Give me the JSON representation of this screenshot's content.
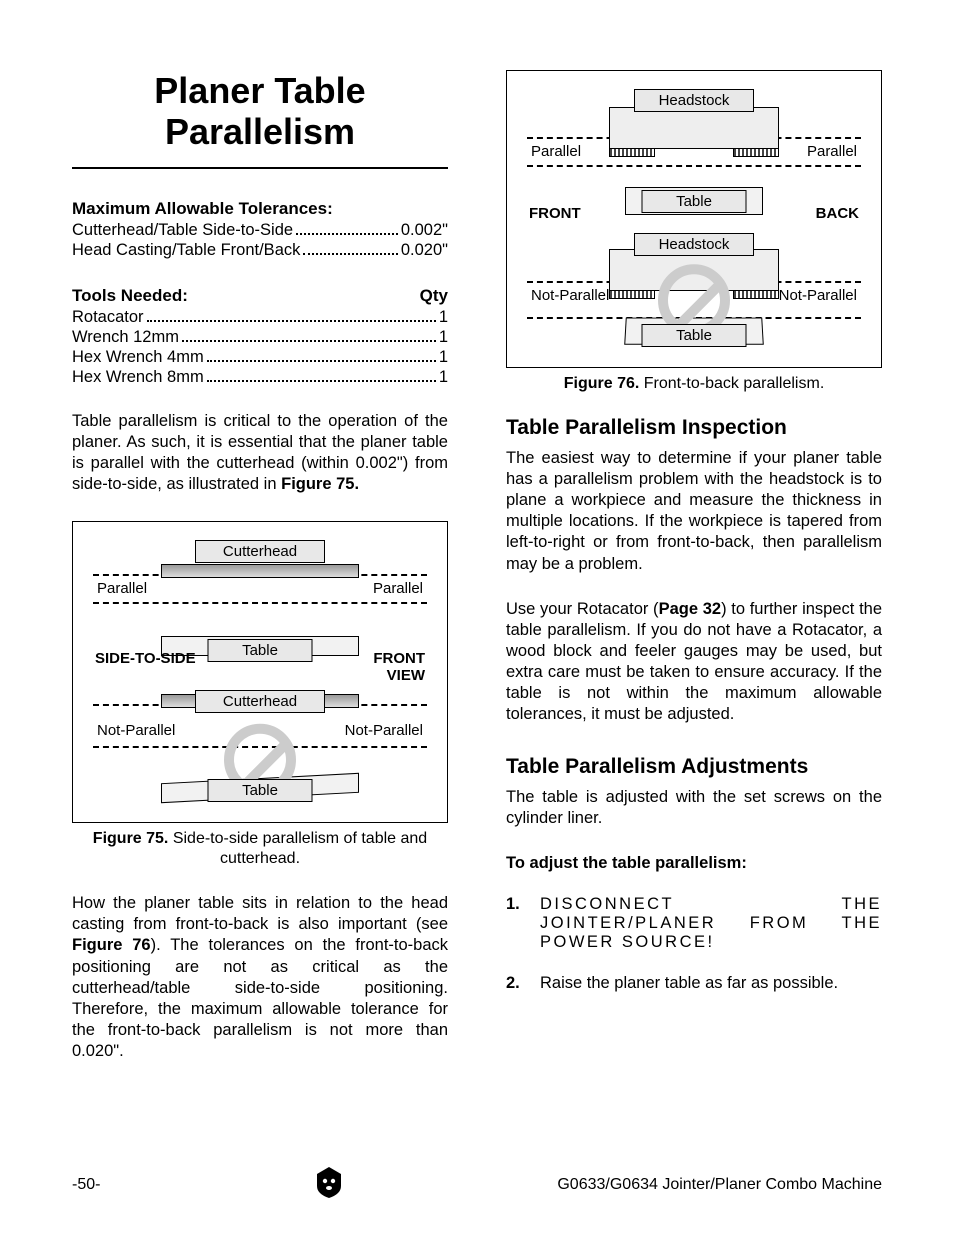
{
  "title_line1": "Planer Table",
  "title_line2": "Parallelism",
  "tolerances": {
    "heading": "Maximum Allowable Tolerances:",
    "rows": [
      {
        "label": "Cutterhead/Table Side-to-Side",
        "value": "0.002\""
      },
      {
        "label": "Head Casting/Table Front/Back",
        "value": "0.020\""
      }
    ]
  },
  "tools": {
    "heading": "Tools Needed:",
    "qty_label": "Qty",
    "rows": [
      {
        "label": "Rotacator",
        "value": "1"
      },
      {
        "label": "Wrench 12mm",
        "value": "1"
      },
      {
        "label": "Hex Wrench 4mm",
        "value": "1"
      },
      {
        "label": "Hex Wrench 8mm",
        "value": "1"
      }
    ]
  },
  "para1_a": "Table parallelism is critical to the operation of the planer. As such, it is essential that the planer table is parallel with the cutterhead (within 0.002\") from side-to-side, as illustrated in ",
  "para1_b": "Figure 75.",
  "fig75": {
    "cutter": "Cutterhead",
    "table": "Table",
    "parallel": "Parallel",
    "notparallel": "Not-Parallel",
    "side": "SIDE-TO-SIDE",
    "front_view_1": "FRONT",
    "front_view_2": "VIEW",
    "caption_num": "Figure 75.",
    "caption_txt": " Side-to-side parallelism of table and cutterhead."
  },
  "para2_a": "How the planer table sits in relation to the head casting from front-to-back is also important (see ",
  "para2_b": "Figure 76",
  "para2_c": "). The tolerances on the front-to-back positioning are not as critical as the cutterhead/table side-to-side positioning. Therefore, the maximum allowable tolerance for the front-to-back parallelism is not more than 0.020\".",
  "fig76": {
    "head": "Headstock",
    "table": "Table",
    "parallel": "Parallel",
    "notparallel": "Not-Parallel",
    "front": "FRONT",
    "back": "BACK",
    "caption_num": "Figure 76.",
    "caption_txt": " Front-to-back parallelism."
  },
  "inspect": {
    "heading": "Table Parallelism Inspection",
    "p1": "The easiest way to determine if your planer table has a parallelism problem with the headstock is to plane a workpiece and measure the thickness in multiple locations. If the workpiece is tapered from left-to-right or from front-to-back, then parallelism may be a problem.",
    "p2_a": "Use your Rotacator (",
    "p2_b": "Page 32",
    "p2_c": ") to further inspect the table parallelism. If you do not have a Rotacator, a wood block and feeler gauges may be used, but extra care must be taken to ensure accuracy. If the table is not within the maximum allowable tolerances, it must be adjusted."
  },
  "adjust": {
    "heading": "Table Parallelism Adjustments",
    "p1": "The table is adjusted with the set screws on the cylinder liner.",
    "intro": "To adjust the table parallelism:",
    "steps": [
      {
        "n": "1.",
        "t": "DISCONNECT THE JOINTER/PLANER FROM THE POWER SOURCE!"
      },
      {
        "n": "2.",
        "t": "Raise the planer table as far as possible."
      }
    ]
  },
  "footer": {
    "page": "-50-",
    "doc": "G0633/G0634 Jointer/Planer Combo Machine"
  }
}
